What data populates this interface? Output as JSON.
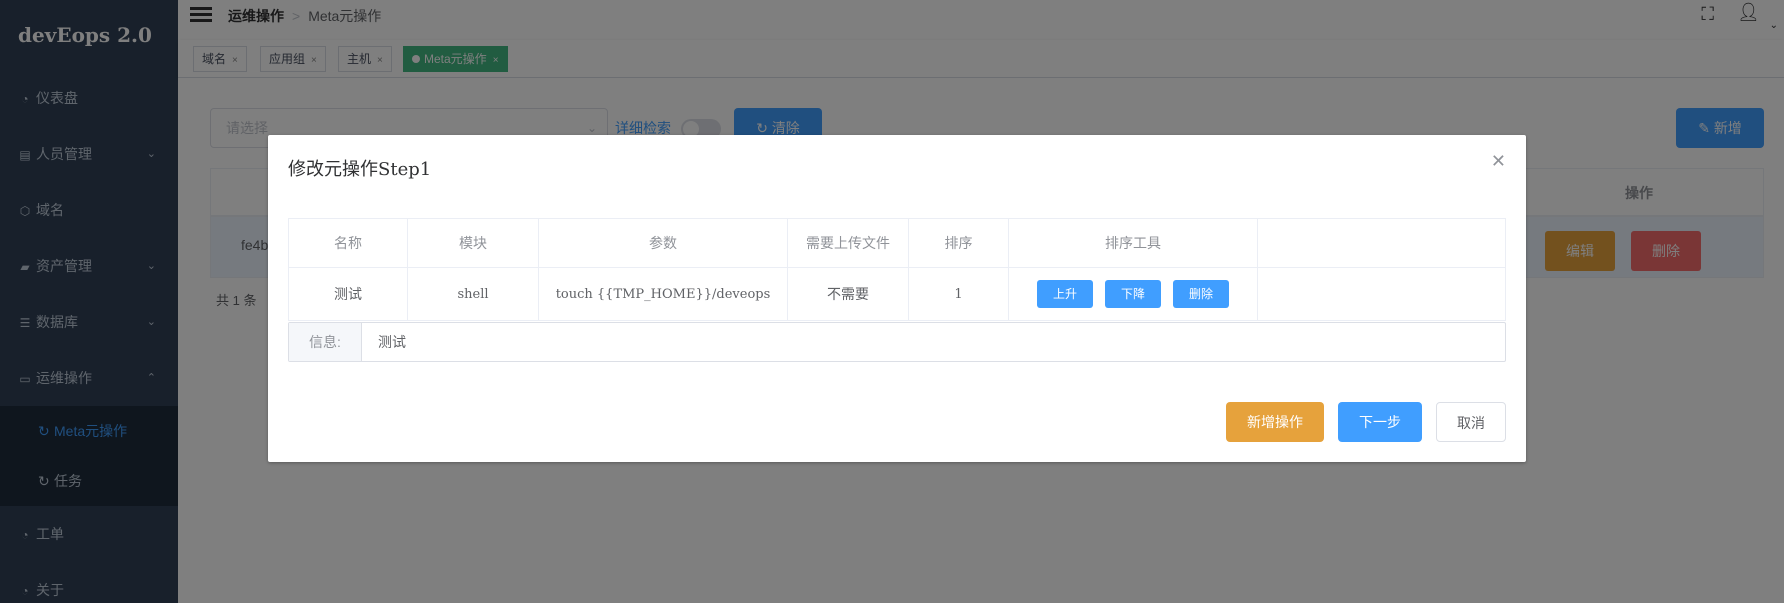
{
  "app": {
    "title": "devEops 2.0"
  },
  "sidebar": {
    "items": [
      {
        "label": "仪表盘",
        "icon": "dashboard-icon"
      },
      {
        "label": "人员管理",
        "icon": "id-card-icon",
        "expandable": true
      },
      {
        "label": "域名",
        "icon": "cube-icon"
      },
      {
        "label": "资产管理",
        "icon": "truck-icon",
        "expandable": true
      },
      {
        "label": "数据库",
        "icon": "database-icon",
        "expandable": true
      },
      {
        "label": "运维操作",
        "icon": "keyboard-icon",
        "expandable": true,
        "expanded": true
      },
      {
        "label": "工单",
        "icon": "dashboard-icon"
      },
      {
        "label": "关于",
        "icon": "dashboard-icon"
      }
    ],
    "submenu": [
      {
        "label": "Meta元操作",
        "active": true
      },
      {
        "label": "任务",
        "active": false
      }
    ]
  },
  "header": {
    "breadcrumb": [
      "运维操作",
      "Meta元操作"
    ]
  },
  "tags": [
    {
      "label": "域名",
      "active": false
    },
    {
      "label": "应用组",
      "active": false
    },
    {
      "label": "主机",
      "active": false
    },
    {
      "label": "Meta元操作",
      "active": true
    }
  ],
  "main": {
    "select_placeholder": "请选择",
    "advanced_search_label": "详细检索",
    "clear_label": "清除",
    "new_label": "新增",
    "table": {
      "operation_header": "操作",
      "row_id_partial": "fe4b",
      "edit_label": "编辑",
      "delete_label": "删除"
    },
    "total_text": "共 1 条"
  },
  "dialog": {
    "title": "修改元操作Step1",
    "columns": [
      "名称",
      "模块",
      "参数",
      "需要上传文件",
      "排序",
      "排序工具"
    ],
    "rows": [
      {
        "name": "测试",
        "module": "shell",
        "params": "touch {{TMP_HOME}}/deveops",
        "upload": "不需要",
        "order": "1",
        "tools": [
          "上升",
          "下降",
          "删除"
        ]
      }
    ],
    "info_label": "信息:",
    "info_value": "测试",
    "buttons": {
      "add": "新增操作",
      "next": "下一步",
      "cancel": "取消"
    }
  },
  "colors": {
    "sidebar_bg": "#304156",
    "primary": "#409eff",
    "warning": "#e6a23c",
    "danger": "#f56c6c",
    "tag_active": "#42b983"
  }
}
